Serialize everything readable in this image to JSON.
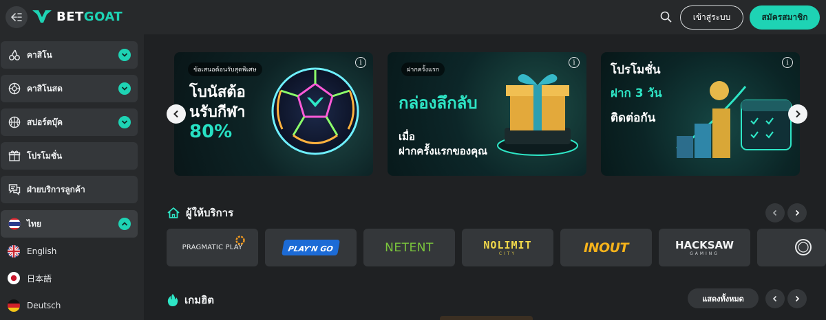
{
  "brand": {
    "logo_bet": "BET",
    "logo_goat": "GOAT",
    "accent": "#1ed3b4"
  },
  "header": {
    "login_label": "เข้าสู่ระบบ",
    "signup_label": "สมัครสมาชิก"
  },
  "sidebar": {
    "items": [
      {
        "label": "คาสิโน",
        "icon": "cherries-icon"
      },
      {
        "label": "คาสิโนสด",
        "icon": "roulette-icon"
      },
      {
        "label": "สปอร์ตบุ๊ค",
        "icon": "basketball-icon"
      },
      {
        "label": "โปรโมชั่น",
        "icon": "gift-icon"
      },
      {
        "label": "ฝ่ายบริการลูกค้า",
        "icon": "chat-icon"
      },
      {
        "label": "ไทย",
        "icon": "thai-flag-icon"
      }
    ],
    "languages": [
      {
        "label": "English",
        "icon": "uk-flag-icon"
      },
      {
        "label": "日本語",
        "icon": "japan-flag-icon"
      },
      {
        "label": "Deutsch",
        "icon": "germany-flag-icon"
      }
    ]
  },
  "banners": [
    {
      "tag": "ข้อเสนอต้อนรับสุดพิเศษ",
      "line1": "โบนัสต้อ",
      "line2": "นรับกีฬา",
      "line3": "80%"
    },
    {
      "tag": "ฝากครั้งแรก",
      "line1": "กล่องลึกลับ",
      "line2": "เมื่อ",
      "line3": "ฝากครั้งแรกของคุณ"
    },
    {
      "line1": "โปรโมชั่น",
      "line2": "ฝาก 3 วัน",
      "line3": "ติดต่อกัน"
    }
  ],
  "sections": {
    "providers_title": "ผู้ให้บริการ",
    "hot_games_title": "เกมฮิต",
    "show_all_label": "แสดงทั้งหมด"
  },
  "providers": [
    {
      "name": "PRAGMATIC PLAY"
    },
    {
      "name": "PLAY'N GO"
    },
    {
      "name": "NETENT"
    },
    {
      "name": "NOLIMIT",
      "sub": "CITY"
    },
    {
      "name": "INOUT"
    },
    {
      "name": "HACKSAW",
      "sub": "GAMING"
    }
  ]
}
